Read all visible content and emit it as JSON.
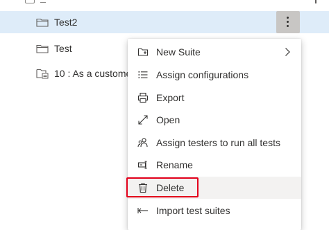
{
  "tree": {
    "rows": [
      {
        "label": "Test2",
        "icon": "folder-icon",
        "selected": true
      },
      {
        "label": "Test",
        "icon": "folder-icon",
        "selected": false
      },
      {
        "label": "10 : As a customer",
        "icon": "requirement-suite-icon",
        "selected": false
      }
    ]
  },
  "more_button": {
    "icon": "more-vertical-icon"
  },
  "context_menu": {
    "items": [
      {
        "label": "New Suite",
        "icon": "new-suite-icon",
        "has_submenu": true
      },
      {
        "label": "Assign configurations",
        "icon": "list-icon"
      },
      {
        "label": "Export",
        "icon": "print-icon"
      },
      {
        "label": "Open",
        "icon": "expand-diagonal-icon"
      },
      {
        "label": "Assign testers to run all tests",
        "icon": "people-icon"
      },
      {
        "label": "Rename",
        "icon": "rename-icon"
      },
      {
        "label": "Delete",
        "icon": "trash-icon",
        "hovered": true,
        "annotated": true
      },
      {
        "label": "Import test suites",
        "icon": "import-icon"
      }
    ]
  },
  "colors": {
    "selected_row": "#deecf9",
    "annotation": "#e3001b",
    "text": "#323130",
    "button_active": "#c8c6c4"
  }
}
